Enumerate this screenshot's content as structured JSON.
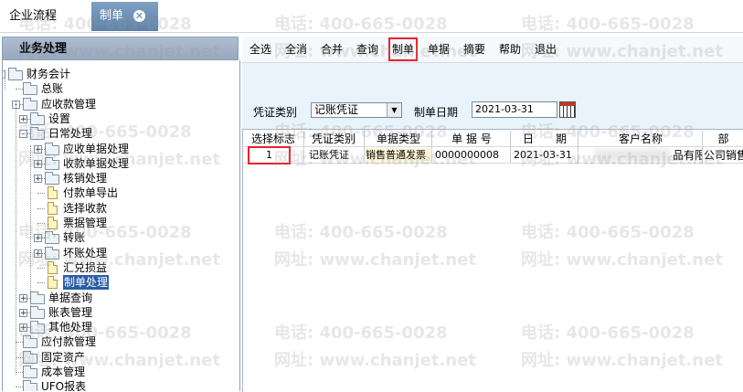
{
  "tabs": {
    "home_label": "企业流程",
    "active_label": "制单",
    "close_glyph": "✕"
  },
  "left_panel": {
    "title": "业务处理",
    "tree": [
      {
        "label": "财务会计",
        "level": 0,
        "type": "folder",
        "toggle": "-"
      },
      {
        "label": "总账",
        "level": 1,
        "type": "folder",
        "toggle": ""
      },
      {
        "label": "应收款管理",
        "level": 1,
        "type": "folder",
        "toggle": "-"
      },
      {
        "label": "设置",
        "level": 2,
        "type": "folder",
        "toggle": "+"
      },
      {
        "label": "日常处理",
        "level": 2,
        "type": "folder",
        "toggle": "-"
      },
      {
        "label": "应收单据处理",
        "level": 3,
        "type": "folder",
        "toggle": "+"
      },
      {
        "label": "收款单据处理",
        "level": 3,
        "type": "folder",
        "toggle": "+"
      },
      {
        "label": "核销处理",
        "level": 3,
        "type": "folder",
        "toggle": "+"
      },
      {
        "label": "付款单导出",
        "level": 3,
        "type": "doc",
        "toggle": ""
      },
      {
        "label": "选择收款",
        "level": 3,
        "type": "doc",
        "toggle": ""
      },
      {
        "label": "票据管理",
        "level": 3,
        "type": "doc",
        "toggle": ""
      },
      {
        "label": "转账",
        "level": 3,
        "type": "folder",
        "toggle": "+"
      },
      {
        "label": "坏账处理",
        "level": 3,
        "type": "folder",
        "toggle": "+"
      },
      {
        "label": "汇兑损益",
        "level": 3,
        "type": "doc",
        "toggle": ""
      },
      {
        "label": "制单处理",
        "level": 3,
        "type": "doc",
        "toggle": "",
        "selected": true
      },
      {
        "label": "单据查询",
        "level": 2,
        "type": "folder",
        "toggle": "+"
      },
      {
        "label": "账表管理",
        "level": 2,
        "type": "folder",
        "toggle": "+"
      },
      {
        "label": "其他处理",
        "level": 2,
        "type": "folder",
        "toggle": "+"
      },
      {
        "label": "应付款管理",
        "level": 1,
        "type": "folder",
        "toggle": ""
      },
      {
        "label": "固定资产",
        "level": 1,
        "type": "folder",
        "toggle": ""
      },
      {
        "label": "成本管理",
        "level": 1,
        "type": "folder",
        "toggle": ""
      },
      {
        "label": "UFO报表",
        "level": 1,
        "type": "folder",
        "toggle": ""
      }
    ]
  },
  "toolbar": {
    "buttons": [
      "全选",
      "全消",
      "合并",
      "查询",
      "制单",
      "单据",
      "摘要",
      "帮助",
      "退出"
    ],
    "highlighted": "制单"
  },
  "filter": {
    "voucher_type_label": "凭证类别",
    "voucher_type_value": "记账凭证",
    "date_label": "制单日期",
    "date_value": "2021-03-31"
  },
  "grid": {
    "columns": [
      "选择标志",
      "凭证类别",
      "单据类型",
      "单 据 号",
      "日　　期",
      "客户名称",
      "部"
    ],
    "rows": [
      {
        "flag": "1",
        "voucher_type": "记账凭证",
        "doc_type": "销售普通发票",
        "doc_no": "0000000008",
        "date": "2021-03-31",
        "customer": "品有限",
        "dept": "公司销售"
      }
    ]
  },
  "watermark": {
    "phone": "电话: 400-665-0028",
    "site": "网址: www.chanjet.net"
  },
  "colors": {
    "tab_active": "#6b8db5",
    "highlight_red": "#e8232a",
    "selection_blue": "#2a5ca8"
  }
}
